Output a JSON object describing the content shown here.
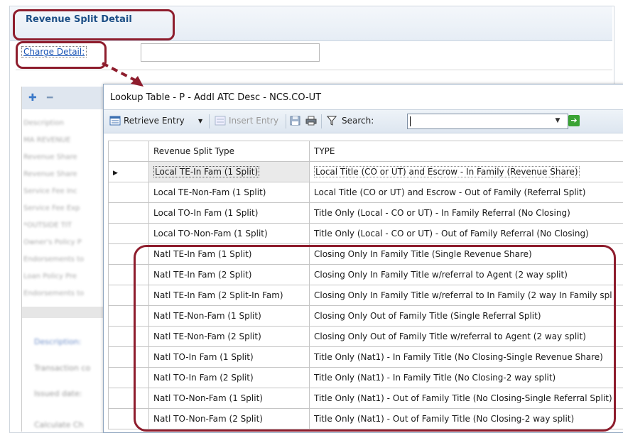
{
  "background": {
    "title": "Revenue Split Detail",
    "charge_detail_label": "Charge Detail:",
    "charge_detail_value": "",
    "left_list": [
      "Description",
      "MA REVENUE",
      "Revenue Share",
      "Revenue Share",
      "Service Fee Inc",
      "Service Fee Exp",
      "*OUTSIDE TIT",
      "Owner's Policy P",
      "Endorsements to",
      "Loan Policy Pre",
      "Endorsements to"
    ],
    "links": [
      "Description:"
    ],
    "labels": [
      "Transaction co",
      "Issued date:",
      "Calculate Ch"
    ]
  },
  "dialog": {
    "title": "Lookup Table - P - Addl ATC Desc - NCS.CO-UT",
    "toolbar": {
      "retrieve_label": "Retrieve Entry",
      "insert_label": "Insert Entry",
      "search_label": "Search:",
      "search_value": ""
    },
    "columns": [
      "Revenue Split Type",
      "TYPE"
    ],
    "rows": [
      [
        "Local TE-In Fam (1 Split)",
        "Local Title (CO or UT) and Escrow - In Family (Revenue Share)"
      ],
      [
        "Local TE-Non-Fam (1 Split)",
        "Local Title (CO or UT) and Escrow - Out of Family (Referral Split)"
      ],
      [
        "Local TO-In Fam (1 Split)",
        "Title Only (Local - CO or UT) - In Family Referral (No Closing)"
      ],
      [
        "Local TO-Non-Fam (1 Split)",
        "Title Only (Local - CO or UT) - Out of Family Referral (No Closing)"
      ],
      [
        "Natl TE-In Fam (1 Split)",
        "Closing Only In Family Title (Single Revenue Share)"
      ],
      [
        "Natl TE-In Fam (2 Split)",
        "Closing Only In Family Title w/referral to Agent (2 way split)"
      ],
      [
        "Natl TE-In Fam (2 Split-In Fam)",
        "Closing Only In Family Title w/referral to In Family (2 way In Family spl"
      ],
      [
        "Natl TE-Non-Fam (1 Split)",
        "Closing Only Out of Family Title (Single Referral Split)"
      ],
      [
        "Natl TE-Non-Fam (2 Split)",
        "Closing Only Out of Family Title w/referral to Agent (2 way split)"
      ],
      [
        "Natl TO-In Fam (1 Split)",
        "Title Only (Nat1) - In Family Title (No Closing-Single Revenue Share)"
      ],
      [
        "Natl TO-In Fam (2 Split)",
        "Title Only (Nat1) - In Family Title (No Closing-2 way split)"
      ],
      [
        "Natl TO-Non-Fam (1 Split)",
        "Title Only (Nat1) - Out of Family Title (No Closing-Single Referral Split)"
      ],
      [
        "Natl TO-Non-Fam (2 Split)",
        "Title Only (Nat1) - Out of Family Title (No Closing-2 way split)"
      ]
    ],
    "selected_row": 0
  },
  "colors": {
    "highlight": "#8e1d2d",
    "title_blue": "#1d4f86",
    "link_blue": "#1a55b5"
  }
}
